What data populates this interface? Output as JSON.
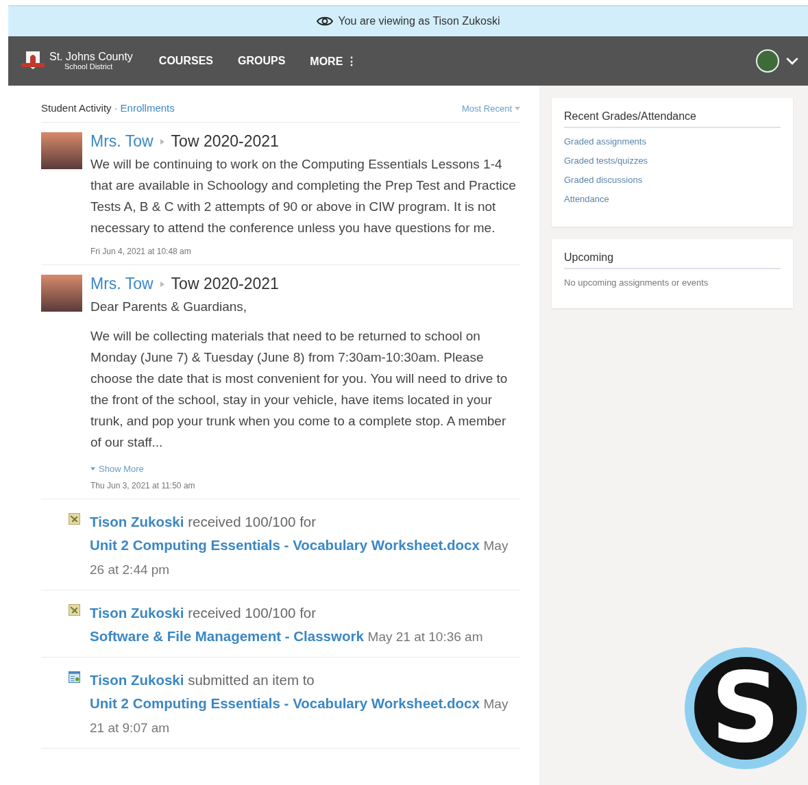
{
  "banner": {
    "text": "You are viewing as Tison Zukoski"
  },
  "nav": {
    "logo_line1": "St. Johns County",
    "logo_line2": "School District",
    "items": [
      {
        "label": "COURSES",
        "kind": "link"
      },
      {
        "label": "GROUPS",
        "kind": "link"
      },
      {
        "label": "MORE",
        "kind": "more",
        "icon": "⋮"
      }
    ]
  },
  "feed_header": {
    "title": "Student Activity",
    "separator": "·",
    "link": "Enrollments",
    "sort": "Most Recent"
  },
  "feed": [
    {
      "kind": "post",
      "author": "Mrs. Tow",
      "course": "Tow 2020-2021",
      "paragraphs": [
        "We will be continuing to work on the Computing Essentials Lessons 1-4 that are available in Schoology and completing the Prep Test and Practice Tests A, B & C with 2 attempts of 90 or above in CIW program. It is not necessary to attend the conference unless you have questions for me."
      ],
      "time": "Fri Jun 4, 2021 at 10:48 am"
    },
    {
      "kind": "post",
      "author": "Mrs. Tow",
      "course": "Tow 2020-2021",
      "paragraphs": [
        "Dear Parents & Guardians,",
        "We will be collecting materials that need to be returned to school on Monday (June 7) & Tuesday (June 8) from 7:30am-10:30am.  Please choose the date that is most convenient for you.  You will need to drive to the front of the school, stay in your vehicle, have items located in your trunk, and pop your trunk when you come to a complete stop.  A member of our staff..."
      ],
      "show_more": "Show More",
      "time": "Thu Jun 3, 2021 at 11:50 am"
    },
    {
      "kind": "grade",
      "actor": "Tison Zukoski",
      "action": "received 100/100 for",
      "target": "Unit 2 Computing Essentials - Vocabulary Worksheet.docx",
      "time": "May 26 at 2:44 pm"
    },
    {
      "kind": "grade",
      "actor": "Tison Zukoski",
      "action": "received 100/100 for",
      "target": "Software & File Management - Classwork",
      "time": "May 21 at 10:36 am"
    },
    {
      "kind": "submission",
      "actor": "Tison Zukoski",
      "action": "submitted an item to",
      "target": "Unit 2 Computing Essentials - Vocabulary Worksheet.docx",
      "time": "May 21 at 9:07 am"
    }
  ],
  "sidebar": [
    {
      "title": "Recent Grades/Attendance",
      "links": [
        "Graded assignments",
        "Graded tests/quizzes",
        "Graded discussions",
        "Attendance"
      ]
    },
    {
      "title": "Upcoming",
      "empty": "No upcoming assignments or events"
    }
  ],
  "logo_badge": {
    "letter": "S"
  }
}
